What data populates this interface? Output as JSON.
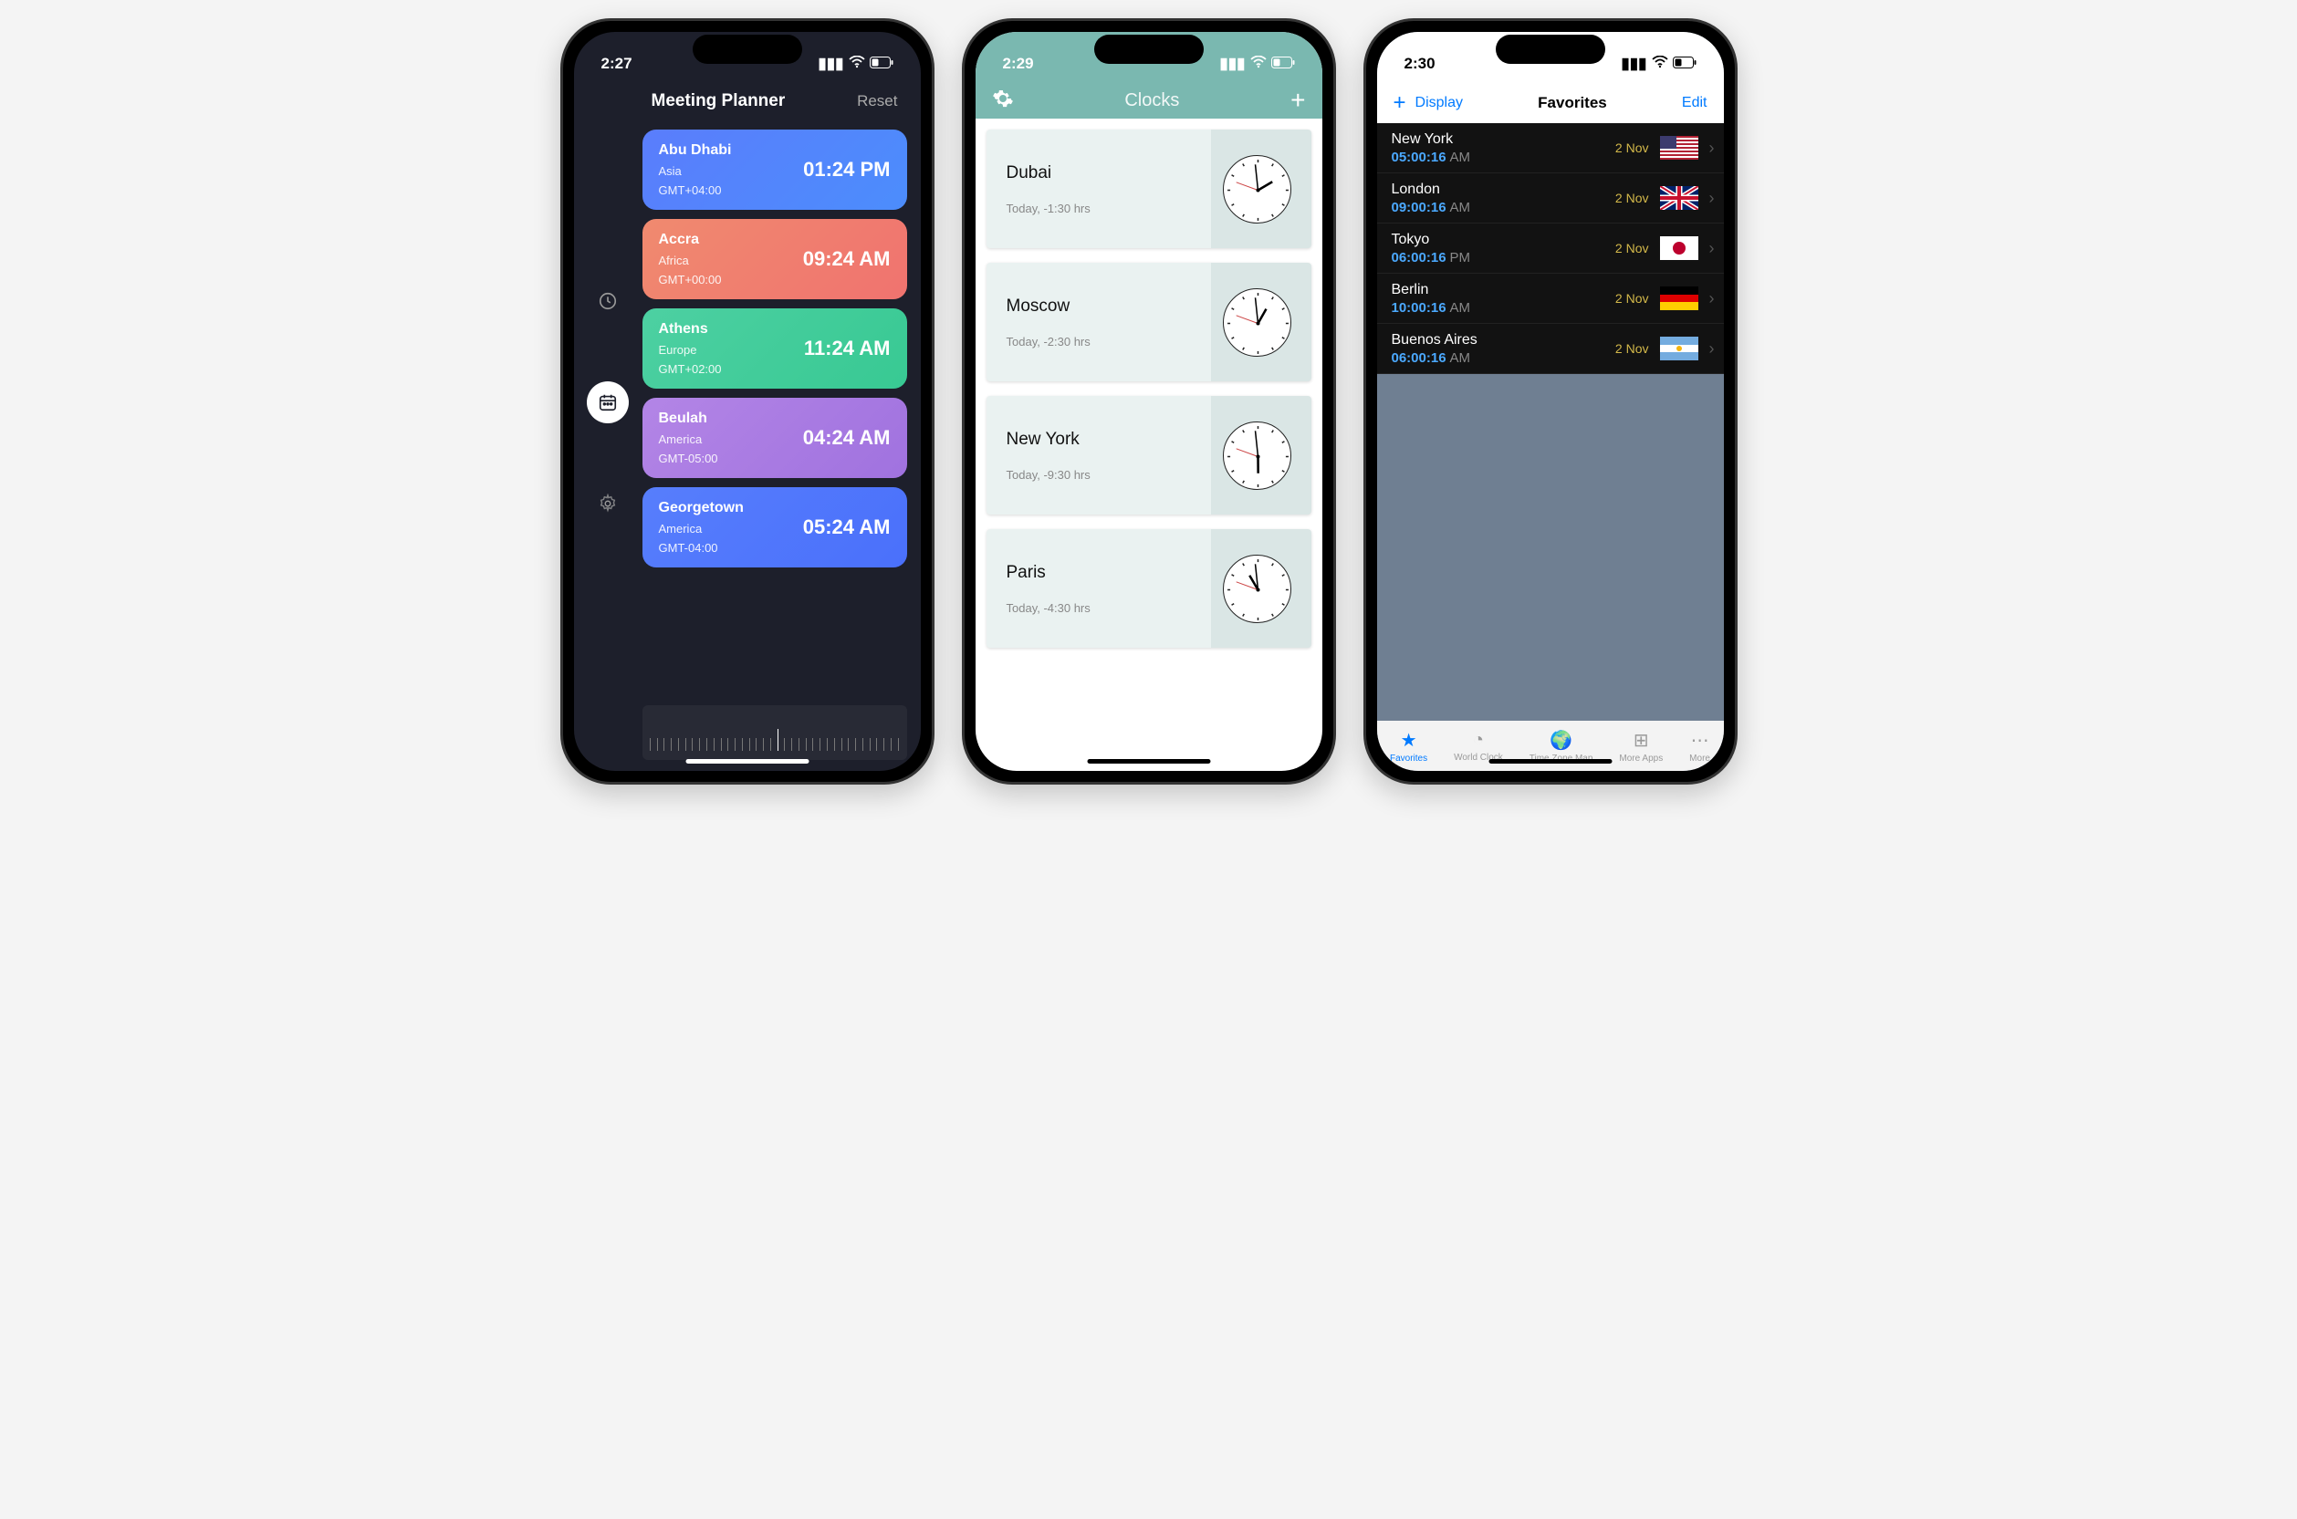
{
  "phone1": {
    "status_time": "2:27",
    "header_title": "Meeting Planner",
    "reset_label": "Reset",
    "cards": [
      {
        "city": "Abu Dhabi",
        "region": "Asia",
        "gmt": "GMT+04:00",
        "time": "01:24 PM",
        "bg": "linear-gradient(135deg,#5a7dfc,#4c8dfc)"
      },
      {
        "city": "Accra",
        "region": "Africa",
        "gmt": "GMT+00:00",
        "time": "09:24 AM",
        "bg": "linear-gradient(135deg,#f08a6f,#f0736f)"
      },
      {
        "city": "Athens",
        "region": "Europe",
        "gmt": "GMT+02:00",
        "time": "11:24 AM",
        "bg": "linear-gradient(135deg,#4dd0a2,#38c993)"
      },
      {
        "city": "Beulah",
        "region": "America",
        "gmt": "GMT-05:00",
        "time": "04:24 AM",
        "bg": "linear-gradient(135deg,#b385e6,#a072df)"
      },
      {
        "city": "Georgetown",
        "region": "America",
        "gmt": "GMT-04:00",
        "time": "05:24 AM",
        "bg": "linear-gradient(135deg,#577efc,#4a70fb)"
      }
    ]
  },
  "phone2": {
    "status_time": "2:29",
    "header_title": "Clocks",
    "cards": [
      {
        "city": "Dubai",
        "sub": "Today, -1:30 hrs",
        "hour": 1,
        "min": 59
      },
      {
        "city": "Moscow",
        "sub": "Today, -2:30 hrs",
        "hour": 0,
        "min": 59
      },
      {
        "city": "New York",
        "sub": "Today, -9:30 hrs",
        "hour": 5,
        "min": 59
      },
      {
        "city": "Paris",
        "sub": "Today, -4:30 hrs",
        "hour": 10,
        "min": 59
      }
    ]
  },
  "phone3": {
    "status_time": "2:30",
    "toolbar": {
      "display": "Display",
      "title": "Favorites",
      "edit": "Edit"
    },
    "rows": [
      {
        "city": "New York",
        "time": "05:00:16",
        "ampm": "AM",
        "date": "2 Nov",
        "flag": "us"
      },
      {
        "city": "London",
        "time": "09:00:16",
        "ampm": "AM",
        "date": "2 Nov",
        "flag": "uk"
      },
      {
        "city": "Tokyo",
        "time": "06:00:16",
        "ampm": "PM",
        "date": "2 Nov",
        "flag": "jp"
      },
      {
        "city": "Berlin",
        "time": "10:00:16",
        "ampm": "AM",
        "date": "2 Nov",
        "flag": "de"
      },
      {
        "city": "Buenos Aires",
        "time": "06:00:16",
        "ampm": "AM",
        "date": "2 Nov",
        "flag": "ar"
      }
    ],
    "tabs": [
      {
        "label": "Favorites",
        "icon": "★",
        "active": true
      },
      {
        "label": "World Clock",
        "icon": "◔",
        "active": false
      },
      {
        "label": "Time Zone Map",
        "icon": "🌍",
        "active": false
      },
      {
        "label": "More Apps",
        "icon": "⊞",
        "active": false
      },
      {
        "label": "More",
        "icon": "⋯",
        "active": false
      }
    ]
  }
}
